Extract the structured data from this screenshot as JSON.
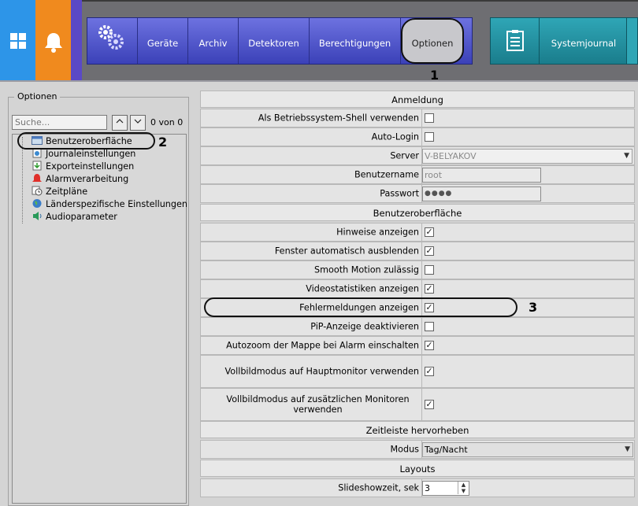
{
  "topbar": {
    "menu": {
      "geraete": "Geräte",
      "archiv": "Archiv",
      "detektoren": "Detektoren",
      "berechtigungen": "Berechtigungen",
      "optionen": "Optionen"
    },
    "systemjournal": "Systemjournal",
    "callout": "1"
  },
  "left": {
    "legend": "Optionen",
    "search_placeholder": "Suche...",
    "search_count": "0 von 0",
    "callout": "2",
    "tree": [
      {
        "label": "Benutzeroberfläche",
        "icon": "window-icon",
        "selected": true
      },
      {
        "label": "Journaleinstellungen",
        "icon": "journal-icon"
      },
      {
        "label": "Exporteinstellungen",
        "icon": "export-icon"
      },
      {
        "label": "Alarmverarbeitung",
        "icon": "alarm-icon"
      },
      {
        "label": "Zeitpläne",
        "icon": "clock-icon"
      },
      {
        "label": "Länderspezifische Einstellungen",
        "icon": "globe-icon"
      },
      {
        "label": "Audioparameter",
        "icon": "speaker-icon"
      }
    ]
  },
  "right": {
    "callout": "3",
    "sections": {
      "anmeldung": "Anmeldung",
      "benutzeroberflaeche": "Benutzeroberfläche",
      "zeitleiste": "Zeitleiste hervorheben",
      "layouts": "Layouts"
    },
    "anmeldung_rows": {
      "shell": {
        "label": "Als Betriebssystem-Shell verwenden",
        "checked": false
      },
      "autologin": {
        "label": "Auto-Login",
        "checked": false
      },
      "server": {
        "label": "Server",
        "value": "V-BELYAKOV"
      },
      "benutzername": {
        "label": "Benutzername",
        "value": "root"
      },
      "passwort": {
        "label": "Passwort",
        "value": "●●●●"
      }
    },
    "ui_rows": [
      {
        "label": "Hinweise anzeigen",
        "checked": true
      },
      {
        "label": "Fenster automatisch ausblenden",
        "checked": true
      },
      {
        "label": "Smooth Motion zulässig",
        "checked": false
      },
      {
        "label": "Videostatistiken anzeigen",
        "checked": true
      },
      {
        "label": "Fehlermeldungen anzeigen",
        "checked": true
      },
      {
        "label": "PiP-Anzeige deaktivieren",
        "checked": false
      },
      {
        "label": "Autozoom der Mappe bei Alarm einschalten",
        "checked": true
      },
      {
        "label": "Vollbildmodus auf Hauptmonitor verwenden",
        "checked": true
      },
      {
        "label": "Vollbildmodus auf zusätzlichen Monitoren verwenden",
        "checked": true
      }
    ],
    "modus": {
      "label": "Modus",
      "value": "Tag/Nacht"
    },
    "slideshow": {
      "label": "Slideshowzeit, sek",
      "value": "3"
    }
  }
}
